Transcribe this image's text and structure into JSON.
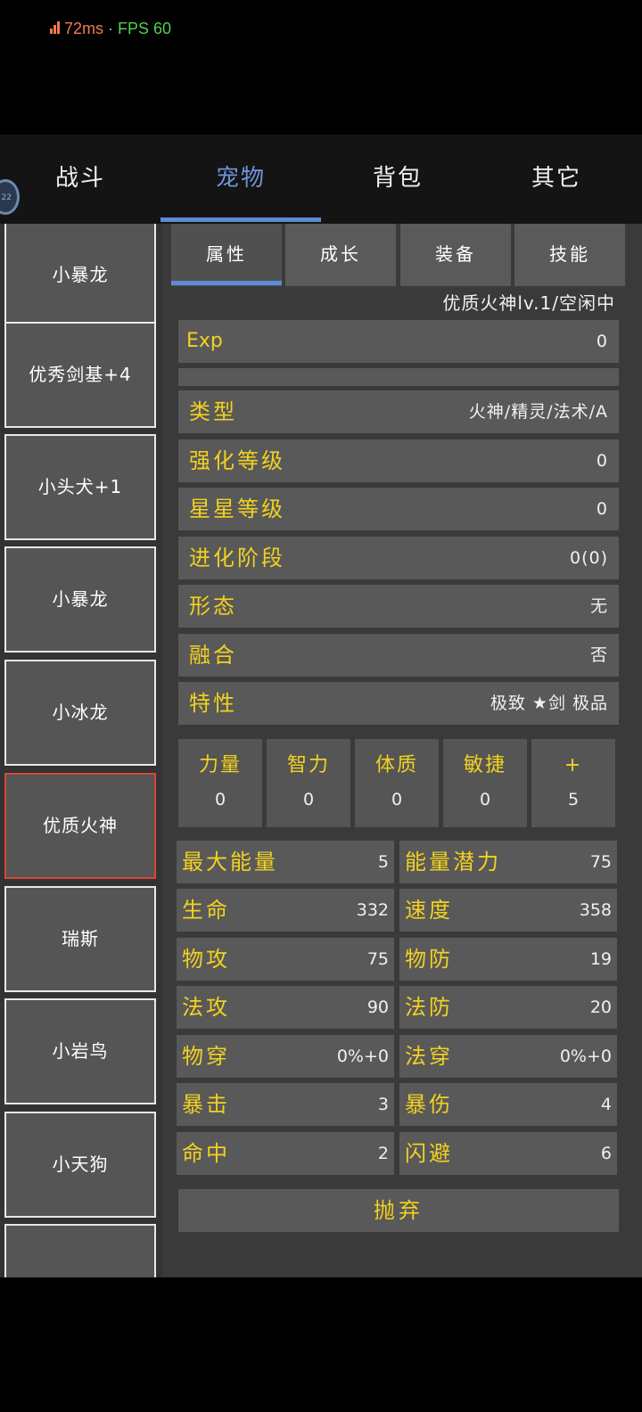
{
  "status": {
    "ping": "72ms",
    "separator": " · ",
    "fps": "FPS 60"
  },
  "avatar": {
    "text": "22"
  },
  "nav": {
    "tabs": [
      "战斗",
      "宠物",
      "背包",
      "其它"
    ],
    "active": 1
  },
  "pets": [
    "小暴龙",
    "优秀剑基+4",
    "小头犬+1",
    "小暴龙",
    "小冰龙",
    "优质火神",
    "瑞斯",
    "小岩鸟",
    "小天狗",
    ""
  ],
  "selected_pet": 5,
  "subtabs": [
    "属性",
    "成长",
    "装备",
    "技能"
  ],
  "pet_title": "优质火神lv.1/空闲中",
  "exp": {
    "label": "Exp",
    "value": "0"
  },
  "info": [
    {
      "label": "类型",
      "value": "火神/精灵/法术/A"
    },
    {
      "label": "强化等级",
      "value": "0"
    },
    {
      "label": "星星等级",
      "value": "0"
    },
    {
      "label": "进化阶段",
      "value": "0(0)"
    },
    {
      "label": "形态",
      "value": "无"
    },
    {
      "label": "融合",
      "value": "否"
    },
    {
      "label": "特性",
      "value": "极致 ★剑 极品"
    }
  ],
  "attributes": [
    {
      "name": "力量",
      "value": "0"
    },
    {
      "name": "智力",
      "value": "0"
    },
    {
      "name": "体质",
      "value": "0"
    },
    {
      "name": "敏捷",
      "value": "0"
    },
    {
      "name": "+",
      "value": "5"
    }
  ],
  "stats": [
    {
      "label": "最大能量",
      "value": "5"
    },
    {
      "label": "能量潜力",
      "value": "75"
    },
    {
      "label": "生命",
      "value": "332"
    },
    {
      "label": "速度",
      "value": "358"
    },
    {
      "label": "物攻",
      "value": "75"
    },
    {
      "label": "物防",
      "value": "19"
    },
    {
      "label": "法攻",
      "value": "90"
    },
    {
      "label": "法防",
      "value": "20"
    },
    {
      "label": "物穿",
      "value": "0%+0"
    },
    {
      "label": "法穿",
      "value": "0%+0"
    },
    {
      "label": "暴击",
      "value": "3"
    },
    {
      "label": "暴伤",
      "value": "4"
    },
    {
      "label": "命中",
      "value": "2"
    },
    {
      "label": "闪避",
      "value": "6"
    }
  ],
  "abandon_label": "抛弃",
  "colors": {
    "accent": "#5b8bd6",
    "label_yellow": "#f2d11f",
    "selected_border": "#d9463a"
  }
}
